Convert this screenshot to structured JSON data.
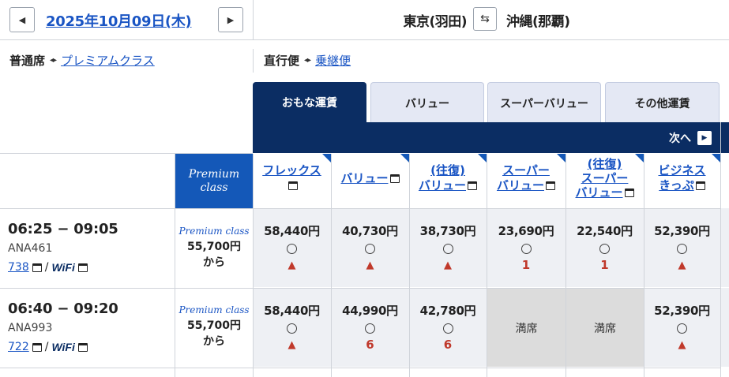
{
  "date_nav": {
    "date": "2025年10月09日(木)",
    "prev_icon": "◀",
    "next_icon": "▶"
  },
  "route": {
    "origin": "東京(羽田)",
    "destination": "沖縄(那覇)",
    "swap_icon": "⇆"
  },
  "toggles": {
    "cabin_current": "普通席",
    "cabin_other": "プレミアムクラス",
    "flight_current": "直行便",
    "flight_other": "乗継便",
    "arrows": "◂▸"
  },
  "tabs": [
    {
      "label": "おもな運賃",
      "active": true
    },
    {
      "label": "バリュー",
      "active": false
    },
    {
      "label": "スーパーバリュー",
      "active": false
    },
    {
      "label": "その他運賃",
      "active": false
    }
  ],
  "next": {
    "label": "次へ",
    "icon": "▶"
  },
  "premium_header": {
    "line1": "Premium",
    "line2": "class"
  },
  "fare_headers": [
    {
      "line1": "フレックス",
      "line2": ""
    },
    {
      "line1": "バリュー",
      "line2": ""
    },
    {
      "line1": "(往復)",
      "line2": "バリュー"
    },
    {
      "line1": "スーパー",
      "line2": "バリュー"
    },
    {
      "line1": "(往復)",
      "line2": "スーパー",
      "line3": "バリュー"
    },
    {
      "line1": "ビジネス",
      "line2": "きっぷ"
    }
  ],
  "flights": [
    {
      "time": "06:25 − 09:05",
      "flight_no": "ANA461",
      "aircraft": "738",
      "wifi": "WiFi",
      "premium_logo": "Premium class",
      "premium_price": "55,700円",
      "premium_from": "から",
      "fares": [
        {
          "price": "58,440円",
          "seats": "▲"
        },
        {
          "price": "40,730円",
          "seats": "▲"
        },
        {
          "price": "38,730円",
          "seats": "▲"
        },
        {
          "price": "23,690円",
          "seats": "1"
        },
        {
          "price": "22,540円",
          "seats": "1"
        },
        {
          "price": "52,390円",
          "seats": "▲"
        }
      ]
    },
    {
      "time": "06:40 − 09:20",
      "flight_no": "ANA993",
      "aircraft": "722",
      "wifi": "WiFi",
      "premium_logo": "Premium class",
      "premium_price": "55,700円",
      "premium_from": "から",
      "fares": [
        {
          "price": "58,440円",
          "seats": "▲"
        },
        {
          "price": "44,990円",
          "seats": "6"
        },
        {
          "price": "42,780円",
          "seats": "6"
        },
        {
          "full": "満席"
        },
        {
          "full": "満席"
        },
        {
          "price": "52,390円",
          "seats": "▲"
        }
      ]
    }
  ],
  "colors": {
    "navy": "#0b2d63",
    "link": "#1a55c4",
    "premium_blue": "#1458b8",
    "seat_red": "#c0392b"
  }
}
